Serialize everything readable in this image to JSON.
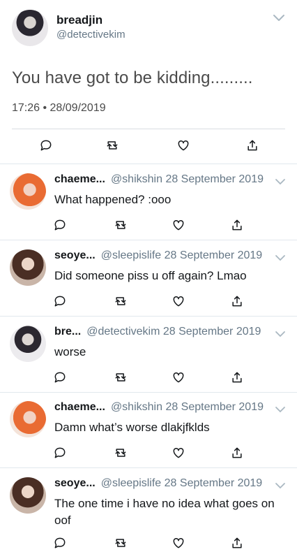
{
  "main_tweet": {
    "name": "breadjin",
    "handle": "@detectivekim",
    "text": "You have got to be kidding.........",
    "timestamp": "17:26 • 28/09/2019",
    "icons": [
      "reply-icon",
      "retweet-icon",
      "like-icon",
      "share-icon"
    ]
  },
  "replies": [
    {
      "name": "chaeme...",
      "handle": "@shikshin",
      "date": "28 September 2019",
      "text": "What happened? :ooo",
      "avatar": "orange"
    },
    {
      "name": "seoye...",
      "handle": "@sleepislife",
      "date": "28 September 2019",
      "text": "Did someone piss u off again? Lmao",
      "avatar": "brown"
    },
    {
      "name": "bre...",
      "handle": "@detectivekim",
      "date": "28 September 2019",
      "text": "worse",
      "avatar": "dark"
    },
    {
      "name": "chaeme...",
      "handle": "@shikshin",
      "date": "28 September 2019",
      "text": "Damn what’s worse dlakjfklds",
      "avatar": "orange"
    },
    {
      "name": "seoye...",
      "handle": "@sleepislife",
      "date": "28 September 2019",
      "text": "The one time i have no idea what goes on oof",
      "avatar": "brown"
    }
  ],
  "colors": {
    "text": "#14171a",
    "secondary": "#657786",
    "divider": "#e1e8ed"
  }
}
